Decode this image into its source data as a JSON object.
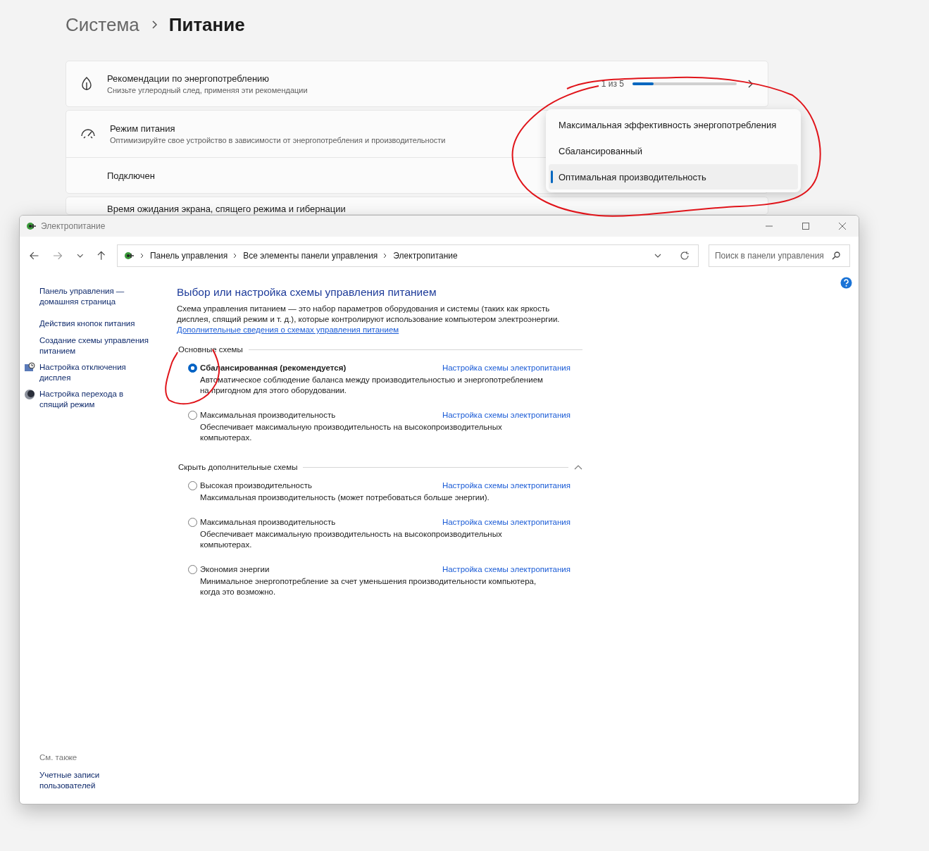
{
  "settings": {
    "breadcrumb": {
      "parent": "Система",
      "current": "Питание"
    },
    "recommendations": {
      "title": "Рекомендации по энергопотреблению",
      "subtitle": "Снизьте углеродный след, применяя эти рекомендации",
      "counter": "1 из 5",
      "level": 0.2
    },
    "power_mode": {
      "title": "Режим питания",
      "subtitle": "Оптимизируйте свое устройство в зависимости от энергопотребления и производительности",
      "sub_row": "Подключен",
      "expanded": true,
      "options": [
        {
          "label": "Максимальная эффективность энергопотребления",
          "selected": false
        },
        {
          "label": "Сбалансированный",
          "selected": false
        },
        {
          "label": "Оптимальная производительность",
          "selected": true
        }
      ]
    },
    "next_card": {
      "title": "Время ожидания экрана, спящего режима и гибернации"
    }
  },
  "window": {
    "title": "Электропитание",
    "address": [
      "Панель управления",
      "Все элементы панели управления",
      "Электропитание"
    ],
    "search": {
      "placeholder": "Поиск в панели управления"
    },
    "sidebar": {
      "items": [
        {
          "label": "Панель управления — домашняя страница",
          "kind": "plain"
        },
        {
          "label": "Действия кнопок питания",
          "kind": "plain"
        },
        {
          "label": "Создание схемы управления питанием",
          "kind": "plain"
        },
        {
          "label": "Настройка отключения дисплея",
          "kind": "display"
        },
        {
          "label": "Настройка перехода в спящий режим",
          "kind": "sleep"
        }
      ],
      "see_also": {
        "heading": "См. также",
        "items": [
          "Учетные записи пользователей"
        ]
      }
    },
    "main": {
      "heading": "Выбор или настройка схемы управления питанием",
      "description": "Схема управления питанием — это набор параметров оборудования и системы (таких как яркость дисплея, спящий режим и т. д.), которые контролируют использование компьютером электроэнергии.",
      "link": "Дополнительные сведения о схемах управления питанием",
      "groups": [
        {
          "title": "Основные схемы",
          "plans": [
            {
              "name": "Сбалансированная (рекомендуется)",
              "selected": true,
              "description": "Автоматическое соблюдение баланса между производительностью и энергопотреблением на пригодном для этого оборудовании.",
              "link": "Настройка схемы электропитания"
            },
            {
              "name": "Максимальная производительность",
              "selected": false,
              "description": "Обеспечивает максимальную производительность на высокопроизводительных компьютерах.",
              "link": "Настройка схемы электропитания"
            }
          ]
        },
        {
          "title": "Скрыть дополнительные схемы",
          "expanded": true,
          "plans": [
            {
              "name": "Высокая производительность",
              "selected": false,
              "description": "Максимальная производительность (может потребоваться больше энергии).",
              "link": "Настройка схемы электропитания"
            },
            {
              "name": "Максимальная производительность",
              "selected": false,
              "description": "Обеспечивает максимальную производительность на высокопроизводительных компьютерах.",
              "link": "Настройка схемы электропитания"
            },
            {
              "name": "Экономия энергии",
              "selected": false,
              "description": "Минимальное энергопотребление за счет уменьшения производительности компьютера, когда это возможно.",
              "link": "Настройка схемы электропитания"
            }
          ]
        }
      ]
    }
  }
}
